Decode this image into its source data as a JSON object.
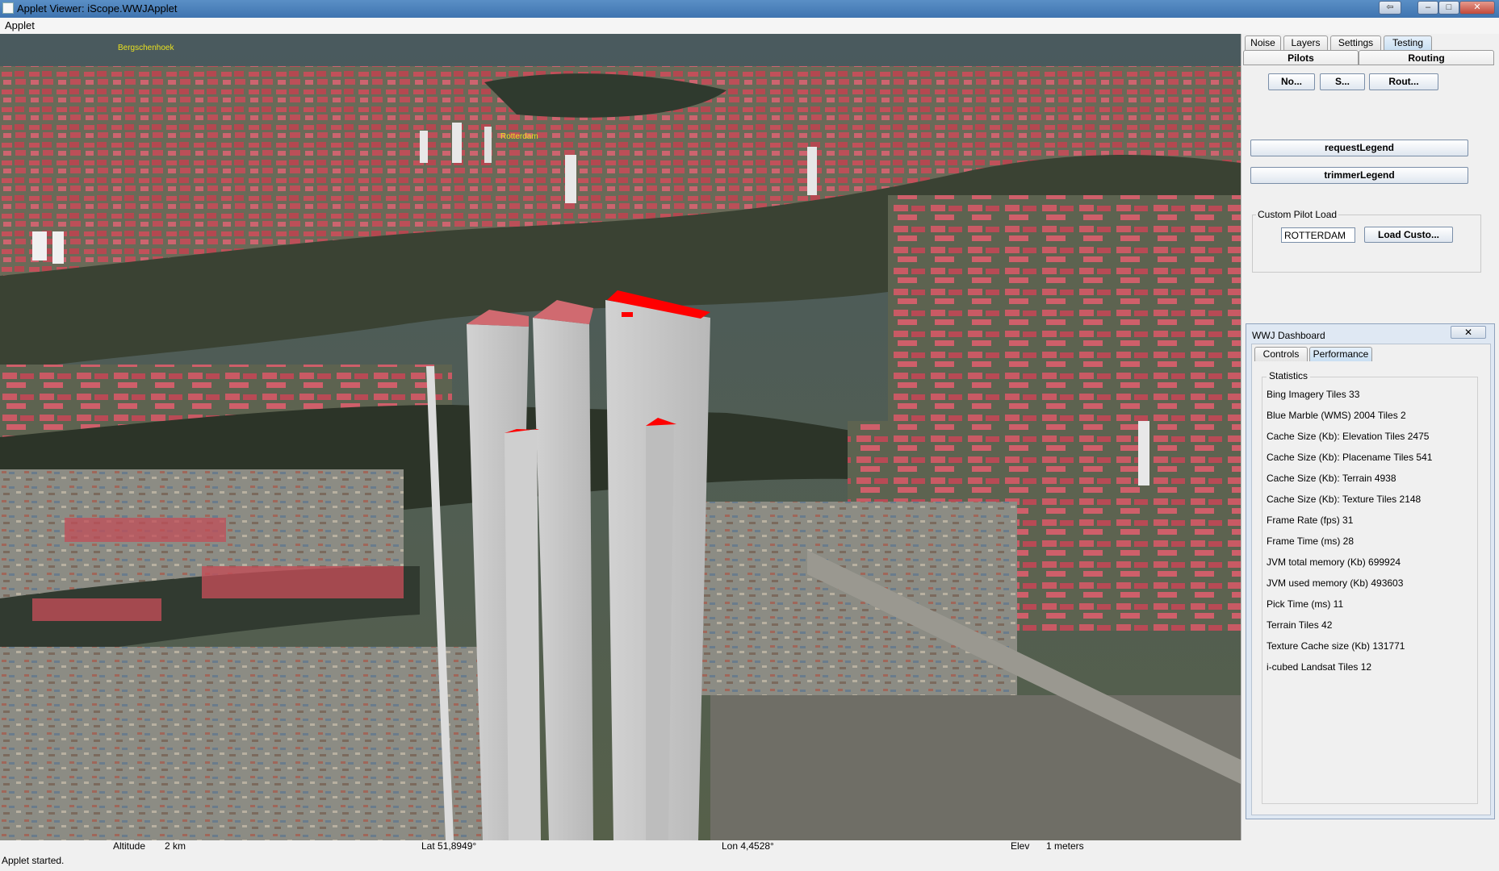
{
  "window": {
    "title": "Applet Viewer: iScope.WWJApplet"
  },
  "menu": {
    "items": [
      "Applet"
    ]
  },
  "map": {
    "placenames": [
      "Bergschenhoek",
      "Rotterdam"
    ]
  },
  "status_bar": {
    "altitude_label": "Altitude",
    "altitude_value": "2 km",
    "lat": "Lat 51,8949°",
    "lon": "Lon 4,4528°",
    "elev_label": "Elev",
    "elev_value": "1 meters"
  },
  "applet_status": "Applet started.",
  "right_panel": {
    "tabs": [
      "Noise",
      "Layers",
      "Settings",
      "Testing"
    ],
    "active_tab": "Testing",
    "subtabs": [
      "Pilots",
      "Routing"
    ],
    "buttons": [
      "No...",
      "S...",
      "Rout..."
    ],
    "request_legend": "requestLegend",
    "trimmer_legend": "trimmerLegend",
    "custom_pilot": {
      "group_title": "Custom Pilot Load",
      "input_value": "ROTTERDAM",
      "load_button": "Load Custo..."
    }
  },
  "dashboard": {
    "title": "WWJ Dashboard",
    "close": "✕",
    "tabs": [
      "Controls",
      "Performance"
    ],
    "active_tab": "Performance",
    "statistics_title": "Statistics",
    "stats": [
      "Bing Imagery Tiles 33",
      "Blue Marble (WMS) 2004 Tiles 2",
      "Cache Size (Kb): Elevation Tiles 2475",
      "Cache Size (Kb): Placename Tiles 541",
      "Cache Size (Kb): Terrain 4938",
      "Cache Size (Kb): Texture Tiles 2148",
      "Frame Rate (fps) 31",
      "Frame Time (ms) 28",
      "JVM total memory (Kb) 699924",
      "JVM used memory (Kb) 493603",
      "Pick Time (ms) 11",
      "Terrain Tiles 42",
      "Texture Cache size (Kb) 131771",
      "i-cubed Landsat Tiles 12"
    ]
  },
  "colors": {
    "roof_red": "#c8505a",
    "highlight_red": "#ff0000",
    "building_grey": "#c6c6c6",
    "water": "#2c3428"
  }
}
